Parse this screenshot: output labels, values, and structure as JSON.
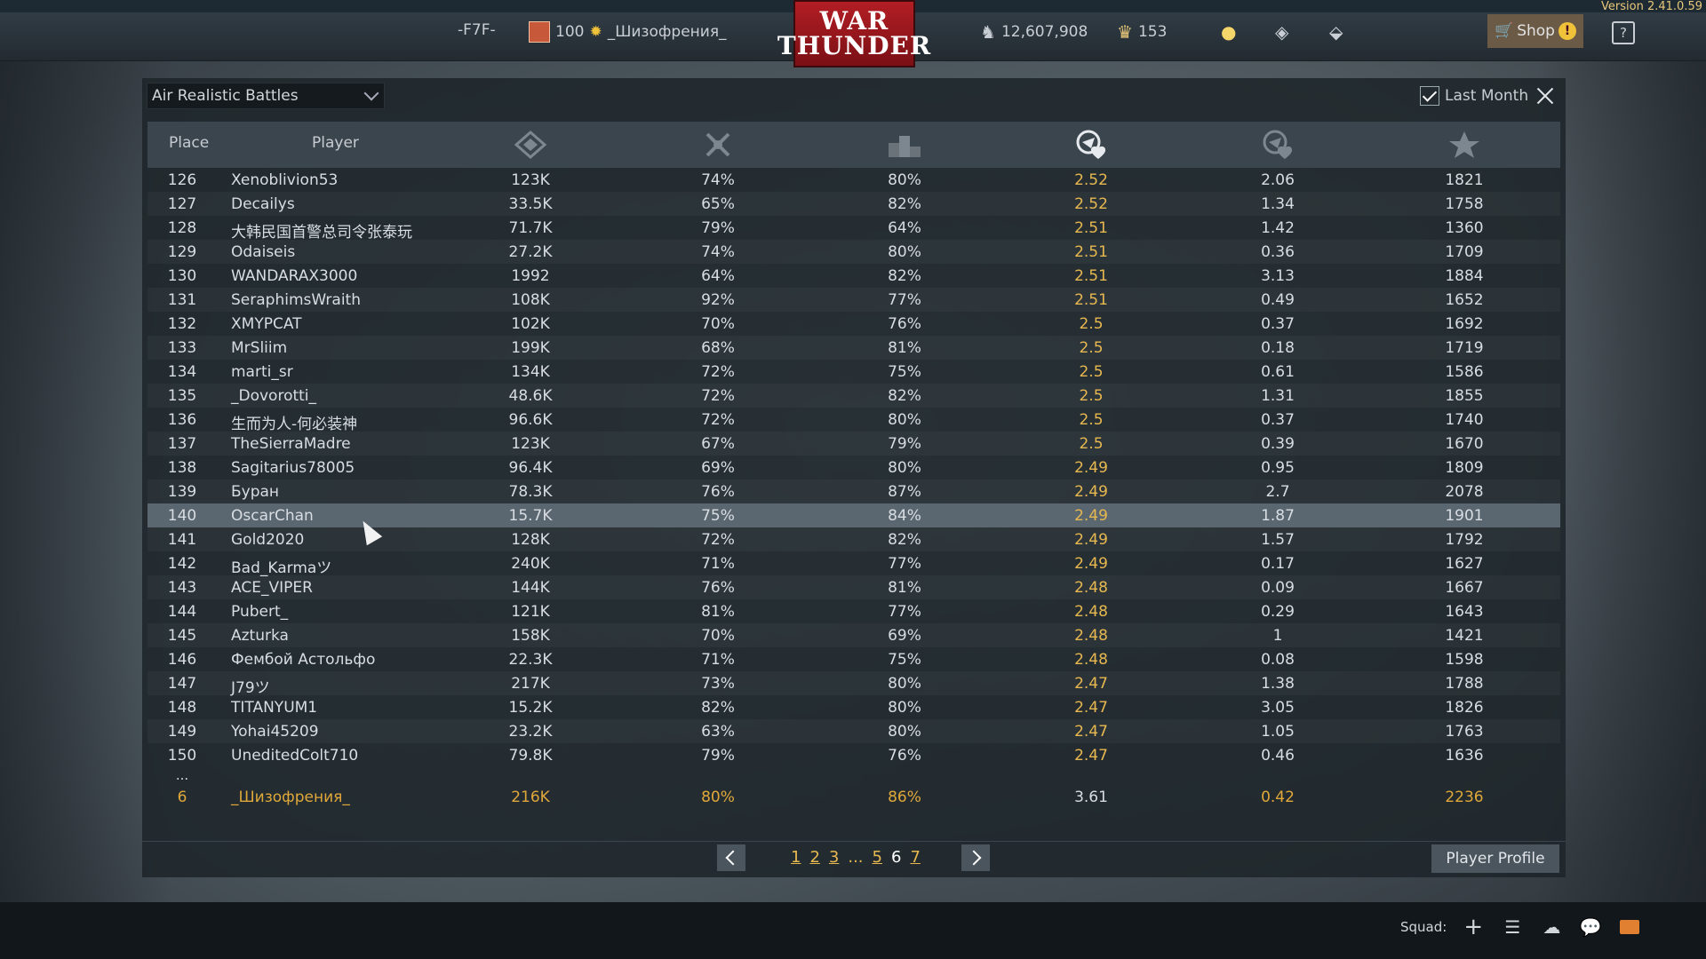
{
  "version": "Version 2.41.0.59",
  "topbar": {
    "clan_tag": "-F7F-",
    "level": "100",
    "player_name": "_Шизофрения_",
    "logo_line1": "WAR",
    "logo_line2": "THUNDER",
    "silver_lions": "12,607,908",
    "golden_eagles": "153",
    "shop_label": "Shop",
    "help_label": "?"
  },
  "filter": {
    "mode": "Air Realistic Battles",
    "last_month_label": "Last Month",
    "last_month_checked": true
  },
  "columns": {
    "place": "Place",
    "player": "Player",
    "icons": [
      "battles-icon",
      "victories-percent-icon",
      "win-ratio-icon",
      "air-kills-per-death-icon",
      "ground-kills-per-death-icon",
      "rating-icon"
    ]
  },
  "rows": [
    {
      "place": "126",
      "name": "Xenoblivion53",
      "c1": "123K",
      "c2": "74%",
      "c3": "80%",
      "c4": "2.52",
      "c5": "2.06",
      "c6": "1821"
    },
    {
      "place": "127",
      "name": "Decailys",
      "c1": "33.5K",
      "c2": "65%",
      "c3": "82%",
      "c4": "2.52",
      "c5": "1.34",
      "c6": "1758"
    },
    {
      "place": "128",
      "name": "大韩民国首警总司令张泰玩",
      "c1": "71.7K",
      "c2": "79%",
      "c3": "64%",
      "c4": "2.51",
      "c5": "1.42",
      "c6": "1360"
    },
    {
      "place": "129",
      "name": "Odaiseis",
      "c1": "27.2K",
      "c2": "74%",
      "c3": "80%",
      "c4": "2.51",
      "c5": "0.36",
      "c6": "1709"
    },
    {
      "place": "130",
      "name": "WANDARAX3000",
      "c1": "1992",
      "c2": "64%",
      "c3": "82%",
      "c4": "2.51",
      "c5": "3.13",
      "c6": "1884"
    },
    {
      "place": "131",
      "name": "SeraphimsWraith",
      "c1": "108K",
      "c2": "92%",
      "c3": "77%",
      "c4": "2.51",
      "c5": "0.49",
      "c6": "1652"
    },
    {
      "place": "132",
      "name": "XMYPCAT",
      "c1": "102K",
      "c2": "70%",
      "c3": "76%",
      "c4": "2.5",
      "c5": "0.37",
      "c6": "1692"
    },
    {
      "place": "133",
      "name": "MrSliim",
      "c1": "199K",
      "c2": "68%",
      "c3": "81%",
      "c4": "2.5",
      "c5": "0.18",
      "c6": "1719"
    },
    {
      "place": "134",
      "name": "marti_sr",
      "c1": "134K",
      "c2": "72%",
      "c3": "75%",
      "c4": "2.5",
      "c5": "0.61",
      "c6": "1586"
    },
    {
      "place": "135",
      "name": "_Dovorotti_",
      "c1": "48.6K",
      "c2": "72%",
      "c3": "82%",
      "c4": "2.5",
      "c5": "1.31",
      "c6": "1855"
    },
    {
      "place": "136",
      "name": "生而为人-何必装神",
      "c1": "96.6K",
      "c2": "72%",
      "c3": "80%",
      "c4": "2.5",
      "c5": "0.37",
      "c6": "1740"
    },
    {
      "place": "137",
      "name": "TheSierraMadre",
      "c1": "123K",
      "c2": "67%",
      "c3": "79%",
      "c4": "2.5",
      "c5": "0.39",
      "c6": "1670"
    },
    {
      "place": "138",
      "name": "Sagitarius78005",
      "c1": "96.4K",
      "c2": "69%",
      "c3": "80%",
      "c4": "2.49",
      "c5": "0.95",
      "c6": "1809"
    },
    {
      "place": "139",
      "name": "Буран",
      "c1": "78.3K",
      "c2": "76%",
      "c3": "87%",
      "c4": "2.49",
      "c5": "2.7",
      "c6": "2078"
    },
    {
      "place": "140",
      "name": "OscarChan",
      "c1": "15.7K",
      "c2": "75%",
      "c3": "84%",
      "c4": "2.49",
      "c5": "1.87",
      "c6": "1901",
      "highlight": true
    },
    {
      "place": "141",
      "name": "Gold2020",
      "c1": "128K",
      "c2": "72%",
      "c3": "82%",
      "c4": "2.49",
      "c5": "1.57",
      "c6": "1792"
    },
    {
      "place": "142",
      "name": "Bad_Karmaツ",
      "c1": "240K",
      "c2": "71%",
      "c3": "77%",
      "c4": "2.49",
      "c5": "0.17",
      "c6": "1627"
    },
    {
      "place": "143",
      "name": "ACE_VIPER",
      "c1": "144K",
      "c2": "76%",
      "c3": "81%",
      "c4": "2.48",
      "c5": "0.09",
      "c6": "1667"
    },
    {
      "place": "144",
      "name": "Pubert_",
      "c1": "121K",
      "c2": "81%",
      "c3": "77%",
      "c4": "2.48",
      "c5": "0.29",
      "c6": "1643"
    },
    {
      "place": "145",
      "name": "Azturka",
      "c1": "158K",
      "c2": "70%",
      "c3": "69%",
      "c4": "2.48",
      "c5": "1",
      "c6": "1421"
    },
    {
      "place": "146",
      "name": "Фембой Астольфо",
      "c1": "22.3K",
      "c2": "71%",
      "c3": "75%",
      "c4": "2.48",
      "c5": "0.08",
      "c6": "1598"
    },
    {
      "place": "147",
      "name": "J79ツ",
      "c1": "217K",
      "c2": "73%",
      "c3": "80%",
      "c4": "2.47",
      "c5": "1.38",
      "c6": "1788"
    },
    {
      "place": "148",
      "name": "TITANYUM1",
      "c1": "15.2K",
      "c2": "82%",
      "c3": "80%",
      "c4": "2.47",
      "c5": "3.05",
      "c6": "1826"
    },
    {
      "place": "149",
      "name": "Yohai45209",
      "c1": "23.2K",
      "c2": "63%",
      "c3": "80%",
      "c4": "2.47",
      "c5": "1.05",
      "c6": "1763"
    },
    {
      "place": "150",
      "name": "UneditedColt710",
      "c1": "79.8K",
      "c2": "79%",
      "c3": "76%",
      "c4": "2.47",
      "c5": "0.46",
      "c6": "1636"
    }
  ],
  "ellipsis": "...",
  "me": {
    "place": "6",
    "name": "_Шизофрения_",
    "c1": "216K",
    "c2": "80%",
    "c3": "86%",
    "c4": "3.61",
    "c5": "0.42",
    "c6": "2236"
  },
  "pager": {
    "pages": [
      "1",
      "2",
      "3"
    ],
    "dots": "...",
    "pages_after": [
      "5"
    ],
    "current": "6",
    "last": "7"
  },
  "profile_button": "Player Profile",
  "bottombar": {
    "squad_label": "Squad:"
  },
  "colors": {
    "accent": "#e8b850",
    "highlight_row": "#5b6770",
    "shop_bg": "#6b5a46",
    "logo_red": "#b21e24"
  }
}
